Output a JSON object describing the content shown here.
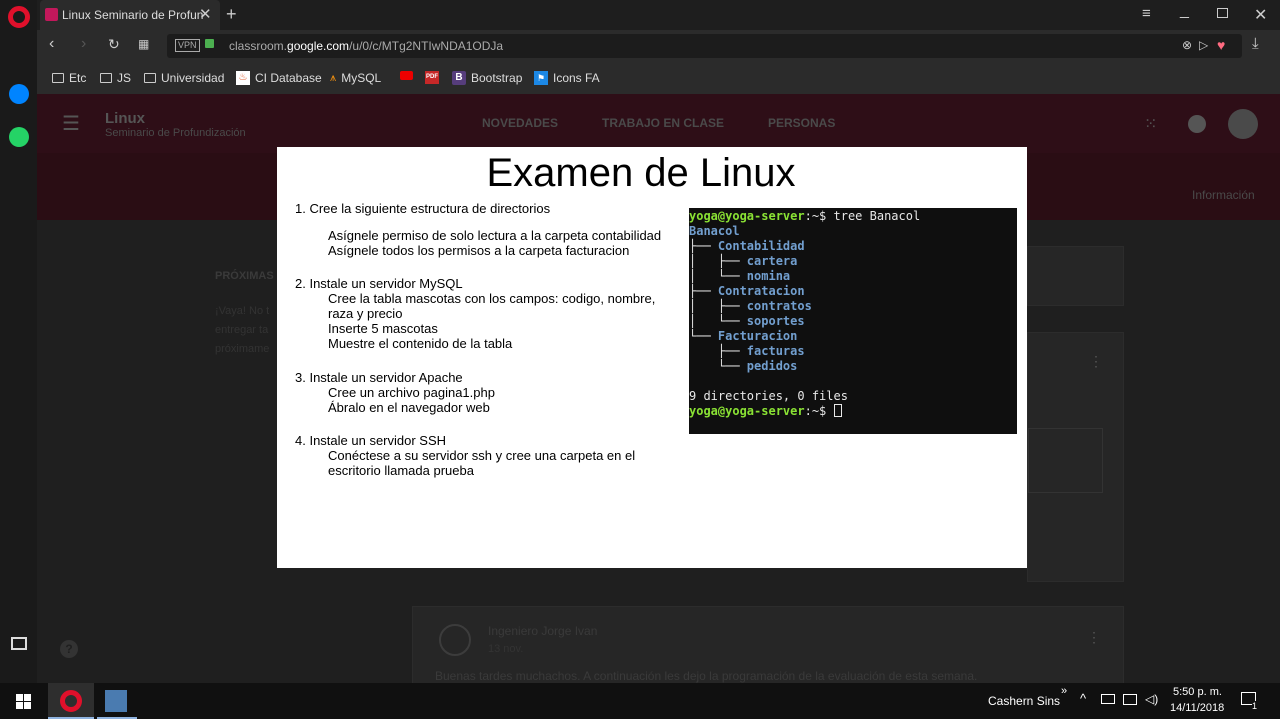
{
  "browser": {
    "tab_title": "Linux Seminario de Profun",
    "url_prefix": "classroom.",
    "url_domain": "google.com",
    "url_path": "/u/0/c/MTg2NTIwNDA1ODJa",
    "vpn_badge": "VPN",
    "bookmarks": [
      "Etc",
      "JS",
      "Universidad",
      "CI Database",
      "MySQL",
      "Bootstrap",
      "Icons FA"
    ]
  },
  "classroom": {
    "course_title": "Linux",
    "course_subtitle": "Seminario de Profundización",
    "tabs": [
      "NOVEDADES",
      "TRABAJO EN CLASE",
      "PERSONAS"
    ],
    "info_label": "Información",
    "upcoming_title": "PRÓXIMAS",
    "upcoming_text": [
      "¡Vaya! No t",
      "entregar ta",
      "próximame"
    ],
    "post_author": "Ingeniero Jorge Ivan",
    "post_date": "13 nov.",
    "post_text": "Buenas tardes muchachos. A continuación les dejo la programación de la evaluación de esta semana."
  },
  "slide": {
    "title": "Examen de Linux",
    "q1_head": "1. Cree la siguiente estructura de directorios",
    "q1_items": [
      "Asígnele permiso de solo lectura a la carpeta contabilidad",
      "Asígnele todos los permisos a la carpeta facturacion"
    ],
    "q2_head": "2. Instale un servidor MySQL",
    "q2_items": [
      "Cree la tabla mascotas con los campos: codigo, nombre,",
      "raza y precio",
      "Inserte 5 mascotas",
      "Muestre el contenido de la tabla"
    ],
    "q3_head": "3. Instale un servidor Apache",
    "q3_items": [
      "Cree un archivo pagina1.php",
      "Ábralo en el navegador web"
    ],
    "q4_head": "4. Instale un servidor SSH",
    "q4_items": [
      "Conéctese a su servidor ssh y cree una carpeta en el",
      "escritorio llamada prueba"
    ]
  },
  "terminal": {
    "prompt_user": "yoga@yoga-server",
    "prompt_tail": ":~$ ",
    "command": "tree Banacol",
    "root": "Banacol",
    "tree": [
      {
        "prefix": "├── ",
        "name": "Contabilidad"
      },
      {
        "prefix": "│   ├── ",
        "name": "cartera"
      },
      {
        "prefix": "│   └── ",
        "name": "nomina"
      },
      {
        "prefix": "├── ",
        "name": "Contratacion"
      },
      {
        "prefix": "│   ├── ",
        "name": "contratos"
      },
      {
        "prefix": "│   └── ",
        "name": "soportes"
      },
      {
        "prefix": "└── ",
        "name": "Facturacion"
      },
      {
        "prefix": "    ├── ",
        "name": "facturas"
      },
      {
        "prefix": "    └── ",
        "name": "pedidos"
      }
    ],
    "summary": "9 directories, 0 files"
  },
  "taskbar": {
    "user": "Cashern Sins",
    "time": "5:50 p. m.",
    "date": "14/11/2018",
    "notif_count": "1"
  },
  "colors": {
    "opera_red": "#e0102b",
    "header_maroon": "#2e0e17",
    "terminal_green": "#8ae234",
    "terminal_blue": "#729fcf"
  }
}
